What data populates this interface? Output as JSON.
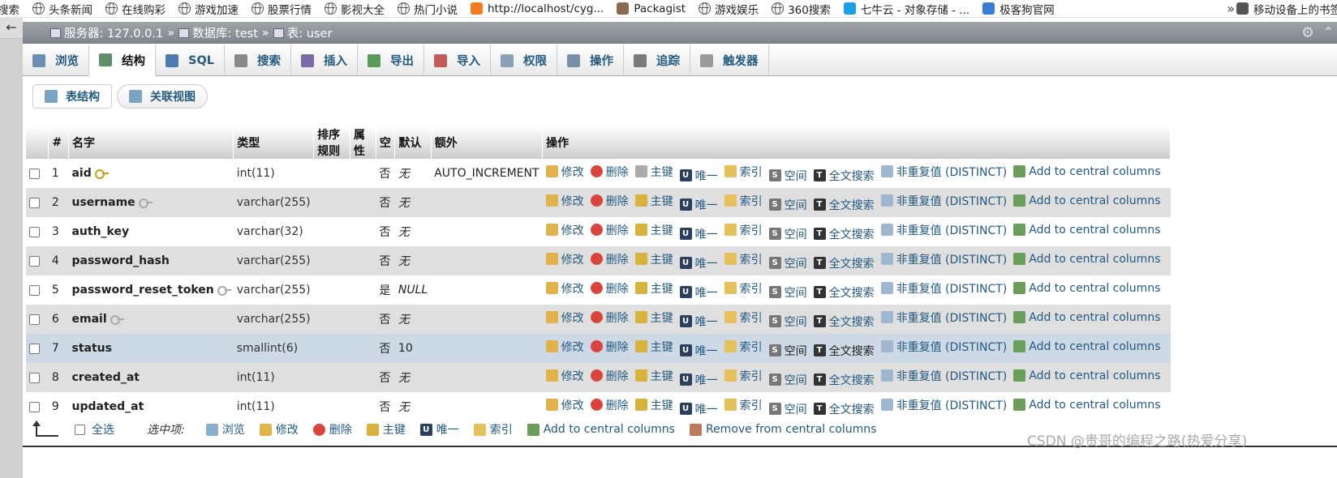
{
  "bookmarks": [
    {
      "label": "搜索",
      "icon": "none"
    },
    {
      "label": "头条新闻",
      "icon": "globe-icon"
    },
    {
      "label": "在线购彩",
      "icon": "globe-icon"
    },
    {
      "label": "游戏加速",
      "icon": "globe-icon"
    },
    {
      "label": "股票行情",
      "icon": "globe-icon"
    },
    {
      "label": "影视大全",
      "icon": "globe-icon"
    },
    {
      "label": "热门小说",
      "icon": "globe-icon"
    },
    {
      "label": "http://localhost/cyg...",
      "icon": "orange-square-icon"
    },
    {
      "label": "Packagist",
      "icon": "packagist-icon"
    },
    {
      "label": "游戏娱乐",
      "icon": "globe-icon"
    },
    {
      "label": "360搜索",
      "icon": "globe-icon"
    },
    {
      "label": "七牛云 - 对象存储 - ...",
      "icon": "qiniu-icon"
    },
    {
      "label": "极客狗官网",
      "icon": "geek-icon"
    },
    {
      "label": "移动设备上的书签",
      "icon": "phone-icon"
    }
  ],
  "more_label": "»",
  "breadcrumb": {
    "server": "服务器: 127.0.0.1",
    "database": "数据库: test",
    "table": "表: user",
    "sep": "»"
  },
  "tabs": [
    {
      "label": "浏览",
      "color": "#6b8fb5"
    },
    {
      "label": "结构",
      "color": "#5f8f6a"
    },
    {
      "label": "SQL",
      "color": "#4c7ab0"
    },
    {
      "label": "搜索",
      "color": "#8a8a8a"
    },
    {
      "label": "插入",
      "color": "#7a6aa8"
    },
    {
      "label": "导出",
      "color": "#5a9a5a"
    },
    {
      "label": "导入",
      "color": "#c25a5a"
    },
    {
      "label": "权限",
      "color": "#8aa0b5"
    },
    {
      "label": "操作",
      "color": "#7a90a8"
    },
    {
      "label": "追踪",
      "color": "#7a7a7a"
    },
    {
      "label": "触发器",
      "color": "#9a9a9a"
    }
  ],
  "subtabs": [
    {
      "label": "表结构"
    },
    {
      "label": "关联视图"
    }
  ],
  "table": {
    "headers": [
      "#",
      "名字",
      "类型",
      "排序规则",
      "属性",
      "空",
      "默认",
      "额外",
      "操作"
    ],
    "rows": [
      {
        "num": "1",
        "name": "aid",
        "key": "primary",
        "type": "int(11)",
        "null": "否",
        "default": "无",
        "extra": "AUTO_INCREMENT"
      },
      {
        "num": "2",
        "name": "username",
        "key": "index",
        "type": "varchar(255)",
        "null": "否",
        "default": "无",
        "extra": ""
      },
      {
        "num": "3",
        "name": "auth_key",
        "key": "none",
        "type": "varchar(32)",
        "null": "否",
        "default": "无",
        "extra": ""
      },
      {
        "num": "4",
        "name": "password_hash",
        "key": "none",
        "type": "varchar(255)",
        "null": "否",
        "default": "无",
        "extra": ""
      },
      {
        "num": "5",
        "name": "password_reset_token",
        "key": "index",
        "type": "varchar(255)",
        "null": "是",
        "default": "NULL",
        "extra": ""
      },
      {
        "num": "6",
        "name": "email",
        "key": "index",
        "type": "varchar(255)",
        "null": "否",
        "default": "无",
        "extra": ""
      },
      {
        "num": "7",
        "name": "status",
        "key": "none",
        "type": "smallint(6)",
        "null": "否",
        "default": "10",
        "extra": ""
      },
      {
        "num": "8",
        "name": "created_at",
        "key": "none",
        "type": "int(11)",
        "null": "否",
        "default": "无",
        "extra": ""
      },
      {
        "num": "9",
        "name": "updated_at",
        "key": "none",
        "type": "int(11)",
        "null": "否",
        "default": "无",
        "extra": ""
      }
    ],
    "actions": {
      "edit": "修改",
      "drop": "删除",
      "primary": "主键",
      "unique": "唯一",
      "index": "索引",
      "spatial": "空间",
      "fulltext": "全文搜索",
      "distinct": "非重复值 (DISTINCT)",
      "central": "Add to central columns"
    }
  },
  "footer": {
    "check_all": "全选",
    "with_selected": "选中项:",
    "browse": "浏览",
    "edit": "修改",
    "drop": "删除",
    "primary": "主键",
    "unique": "唯一",
    "index": "索引",
    "add_central": "Add to central columns",
    "remove_central": "Remove from central columns"
  },
  "watermark": "CSDN @贵哥的编程之路(热爱分享)"
}
